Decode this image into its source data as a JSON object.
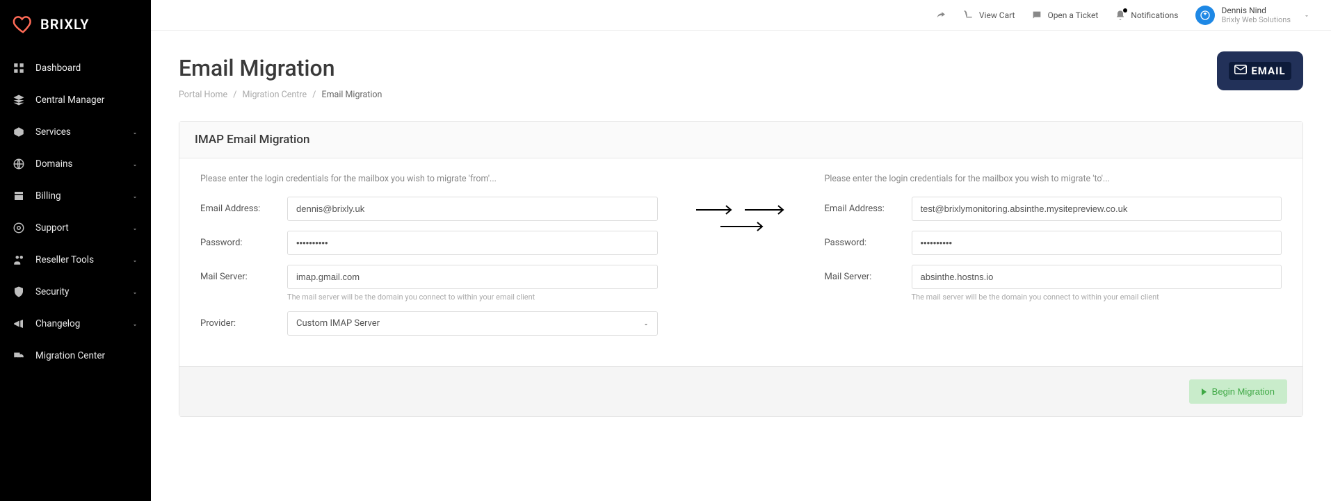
{
  "brand": "BRIXLY",
  "sidebar": {
    "items": [
      {
        "label": "Dashboard",
        "has_children": false
      },
      {
        "label": "Central Manager",
        "has_children": false
      },
      {
        "label": "Services",
        "has_children": true
      },
      {
        "label": "Domains",
        "has_children": true
      },
      {
        "label": "Billing",
        "has_children": true
      },
      {
        "label": "Support",
        "has_children": true
      },
      {
        "label": "Reseller Tools",
        "has_children": true
      },
      {
        "label": "Security",
        "has_children": true
      },
      {
        "label": "Changelog",
        "has_children": true
      },
      {
        "label": "Migration Center",
        "has_children": false
      }
    ]
  },
  "topbar": {
    "view_cart": "View Cart",
    "open_ticket": "Open a Ticket",
    "notifications": "Notifications",
    "user_name": "Dennis Nind",
    "user_org": "Brixly Web Solutions"
  },
  "page_title": "Email Migration",
  "breadcrumb": {
    "items": [
      "Portal Home",
      "Migration Centre",
      "Email Migration"
    ]
  },
  "badge": {
    "text": "EMAIL"
  },
  "card": {
    "title": "IMAP Email Migration",
    "from_intro": "Please enter the login credentials for the mailbox you wish to migrate 'from'...",
    "to_intro": "Please enter the login credentials for the mailbox you wish to migrate 'to'...",
    "labels": {
      "email": "Email Address:",
      "password": "Password:",
      "mail_server": "Mail Server:",
      "provider": "Provider:"
    },
    "helper_mailserver": "The mail server will be the domain you connect to within your email client",
    "from": {
      "email": "dennis@brixly.uk",
      "password": "••••••••••",
      "mail_server": "imap.gmail.com",
      "provider": "Custom IMAP Server"
    },
    "to": {
      "email": "test@brixlymonitoring.absinthe.mysitepreview.co.uk",
      "password": "••••••••••",
      "mail_server": "absinthe.hostns.io"
    },
    "submit_label": "Begin Migration"
  }
}
